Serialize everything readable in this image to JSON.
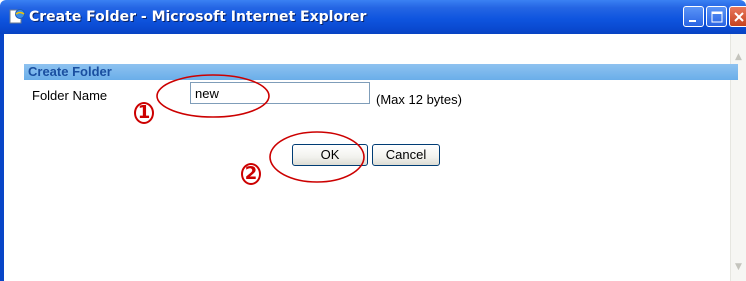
{
  "window": {
    "title": "Create Folder - Microsoft Internet Explorer",
    "icon": "ie-page-icon",
    "controls": [
      "minimize-icon",
      "maximize-icon",
      "close-icon"
    ]
  },
  "section": {
    "title": "Create Folder"
  },
  "form": {
    "folder_name_label": "Folder Name",
    "folder_name_value": "new",
    "max_hint": "(Max 12 bytes)"
  },
  "buttons": {
    "ok_label": "OK",
    "cancel_label": "Cancel"
  },
  "annotations": {
    "marker_1": "1",
    "marker_2": "2",
    "color": "#cc0000"
  },
  "colors": {
    "titlebar": "#0a49d0",
    "section_header": "#6aaee9",
    "section_title": "#1a4fa0"
  }
}
